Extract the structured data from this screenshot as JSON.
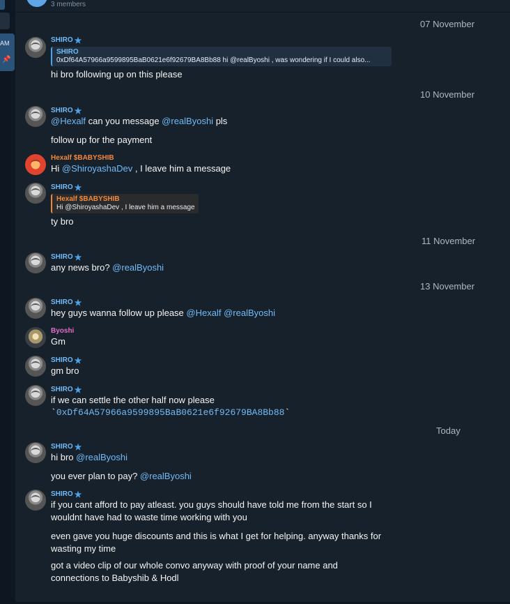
{
  "header": {
    "subtitle": "3 members"
  },
  "sidebar": {
    "label": "AM",
    "pin_icon": "pin-icon"
  },
  "dates": {
    "d1": "07 November",
    "d2": "10 November",
    "d3": "11 November",
    "d4": "13 November",
    "d5": "Today"
  },
  "m1": {
    "sender": "SHIRO",
    "reply_name": "SHIRO",
    "reply_text": "0xDf64A57966a9599895BaB0621e6f92679BA8Bb88  hi @realByoshi , was wondering if I could also...",
    "text": "hi bro following up on this please"
  },
  "m2": {
    "sender": "SHIRO",
    "mention1": "@Hexalf",
    "text_a": " can you message ",
    "mention2": "@realByoshi",
    "text_b": " pls"
  },
  "m3": {
    "text": "follow up for the payment"
  },
  "m4": {
    "sender": "Hexalf $BABYSHIB",
    "text_a": "Hi ",
    "mention": "@ShiroyashaDev",
    "text_b": " , I leave him a message"
  },
  "m5": {
    "sender": "SHIRO",
    "reply_name": "Hexalf $BABYSHIB",
    "reply_text": "Hi @ShiroyashaDev , I leave him a message",
    "text": "ty bro"
  },
  "m6": {
    "sender": "SHIRO",
    "text": "any news bro? ",
    "mention": "@realByoshi"
  },
  "m7": {
    "sender": "SHIRO",
    "text": "hey guys wanna follow up please ",
    "mention1": "@Hexalf",
    "mention2": "@realByoshi"
  },
  "m8": {
    "sender": "Byoshi",
    "text": "Gm"
  },
  "m9": {
    "sender": "SHIRO",
    "text": "gm bro"
  },
  "m10": {
    "sender": "SHIRO",
    "text": "if we can settle the other half now please",
    "code_open": "`",
    "code": "0xDf64A57966a9599895BaB0621e6f92679BA8Bb88",
    "code_close": "`"
  },
  "m11": {
    "sender": "SHIRO",
    "text": "hi bro ",
    "mention": "@realByoshi"
  },
  "m12": {
    "text": "you ever plan to pay? ",
    "mention": "@realByoshi"
  },
  "m13": {
    "sender": "SHIRO",
    "line1": "if you cant afford to pay atleast. you guys should have told me from the start so I",
    "line2": "wouldnt have had to waste time working with you"
  },
  "m14": {
    "line1": "even gave you huge discounts and this is what I get for helping. anyway thanks for",
    "line2": "wasting my time"
  },
  "m15": {
    "line1": "got a video clip of our whole convo anyway with proof of your name and",
    "line2": "connections to Babyshib & Hodl"
  },
  "colors": {
    "background": "#17212b",
    "accent": "#71baf7",
    "hexalf": "#f3883c",
    "byoshi": "#e36ec6"
  }
}
